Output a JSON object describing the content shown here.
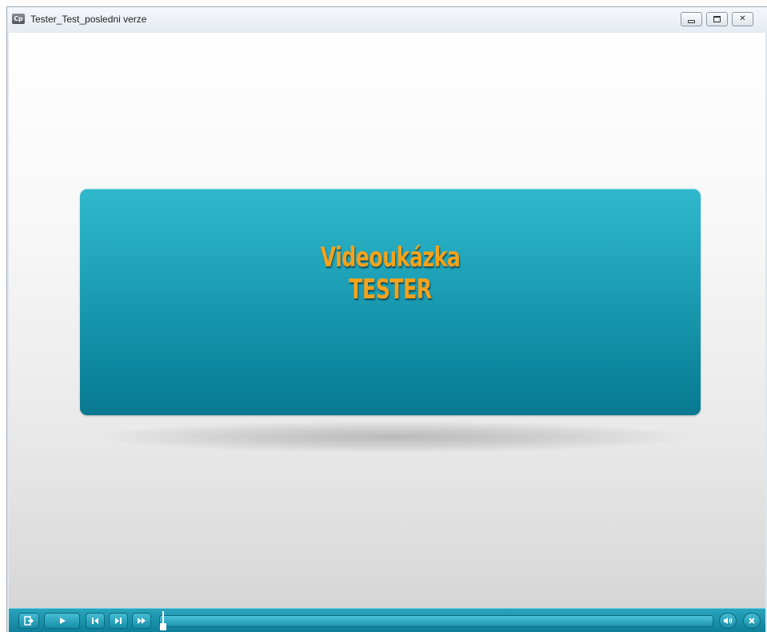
{
  "window": {
    "title": "Tester_Test_posledni verze",
    "app_icon_label": "Cp"
  },
  "banner": {
    "line1": "Videoukázka",
    "line2": "TESTER",
    "background_color": "#1ea1b7",
    "text_color": "#f5a21b"
  },
  "playbar": {
    "progress_fraction": 0.0,
    "buttons": {
      "exit_icon": "exit-icon",
      "play_icon": "play-icon",
      "rewind_icon": "rewind-icon",
      "forward_icon": "forward-icon",
      "fastforward_icon": "fast-forward-icon",
      "audio_icon": "audio-icon",
      "close_icon": "close-icon"
    },
    "accent_color": "#1c93ad"
  }
}
